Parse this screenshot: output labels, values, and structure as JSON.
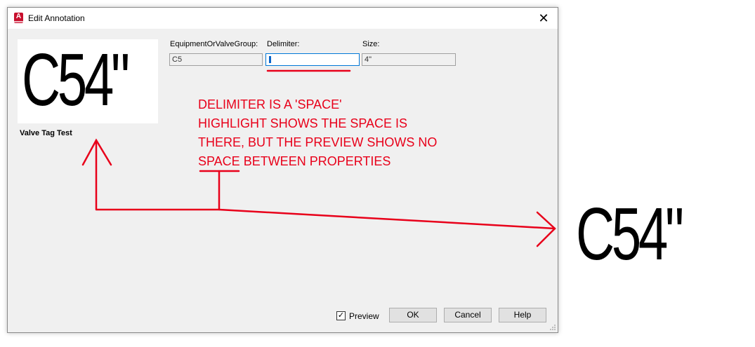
{
  "window": {
    "title": "Edit Annotation",
    "close_glyph": "✕",
    "app_icon": "autocad-plant-icon",
    "app_icon_letter": "A"
  },
  "preview": {
    "text": "C54\"",
    "label": "Valve Tag Test"
  },
  "fields": [
    {
      "label": "EquipmentOrValveGroup:",
      "value": "C5"
    },
    {
      "label": "Delimiter:",
      "value": " "
    },
    {
      "label": "Size:",
      "value": "4\""
    }
  ],
  "footer": {
    "preview_checkbox_label": "Preview",
    "preview_checked": true,
    "check_glyph": "✓",
    "ok_label": "OK",
    "cancel_label": "Cancel",
    "help_label": "Help"
  },
  "annotation": {
    "lines": [
      "DELIMITER IS A 'SPACE'",
      "HIGHLIGHT SHOWS THE SPACE IS",
      "THERE, BUT THE PREVIEW SHOWS NO",
      "SPACE BETWEEN PROPERTIES"
    ],
    "color": "#e8001a",
    "external_preview_text": "C54\""
  }
}
